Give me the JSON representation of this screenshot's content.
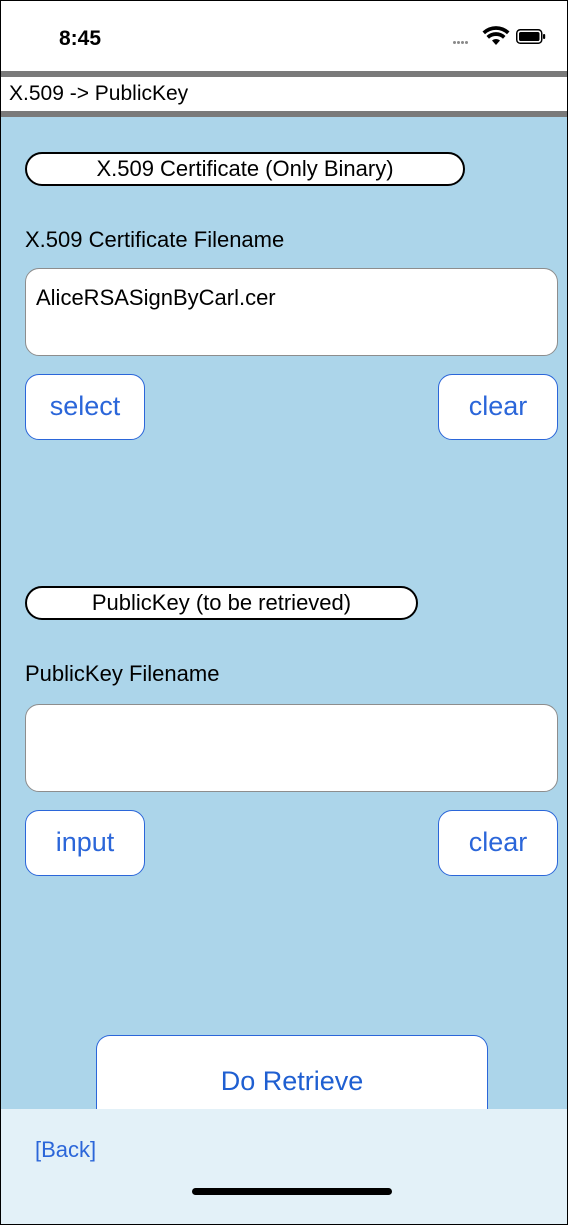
{
  "status_bar": {
    "time": "8:45",
    "icons": [
      "signal-dots-icon",
      "wifi-icon",
      "battery-icon"
    ]
  },
  "title_bar": {
    "title": "X.509 -> PublicKey"
  },
  "certificate_section": {
    "heading": "X.509 Certificate (Only Binary)",
    "filename_label": "X.509 Certificate Filename",
    "filename_value": "AliceRSASignByCarl.cer",
    "select_label": "select",
    "clear_label": "clear"
  },
  "publickey_section": {
    "heading": "PublicKey (to be retrieved)",
    "filename_label": "PublicKey Filename",
    "filename_value": "",
    "input_label": "input",
    "clear_label": "clear"
  },
  "actions": {
    "retrieve_label": "Do Retrieve"
  },
  "footer": {
    "back_label": "[Back]"
  },
  "colors": {
    "content_background": "#acd5ea",
    "bottom_background": "#e3f1f8",
    "accent": "#2b66d9",
    "title_bar_border": "#7a7a7a"
  }
}
